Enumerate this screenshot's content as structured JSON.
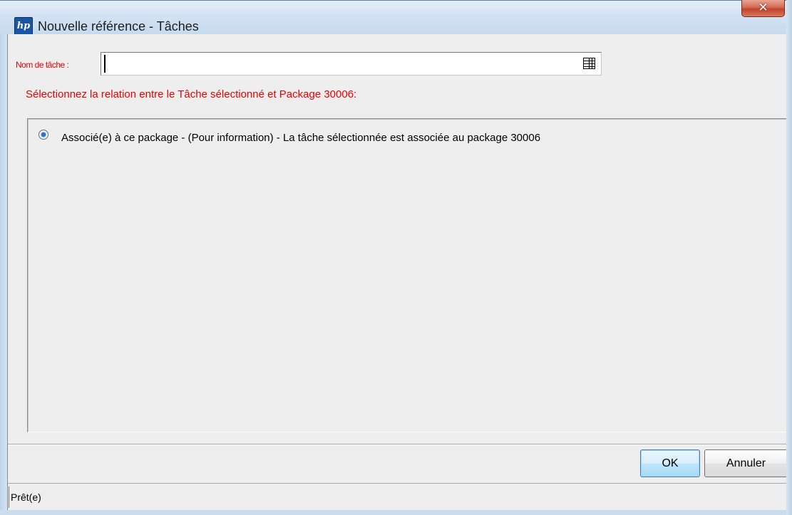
{
  "window": {
    "title": "Nouvelle référence - Tâches",
    "app_icon_text": "hp",
    "close_glyph": "✕"
  },
  "form": {
    "name_label": "Nom de tâche :",
    "name_value": "",
    "lookup_icon": "list-lookup-icon",
    "relation_prompt": "Sélectionnez la relation entre le Tâche sélectionné et Package 30006:"
  },
  "relations": [
    {
      "label": "Associé(e) à ce package - (Pour information) - La tâche sélectionnée est associée au package 30006",
      "selected": true
    }
  ],
  "buttons": {
    "ok_label": "OK",
    "cancel_label": "Annuler"
  },
  "status": {
    "text": "Prêt(e)"
  },
  "colors": {
    "label_red": "#ee0000",
    "close_red": "#c0442b",
    "default_button_blue": "#3c7fb1"
  }
}
